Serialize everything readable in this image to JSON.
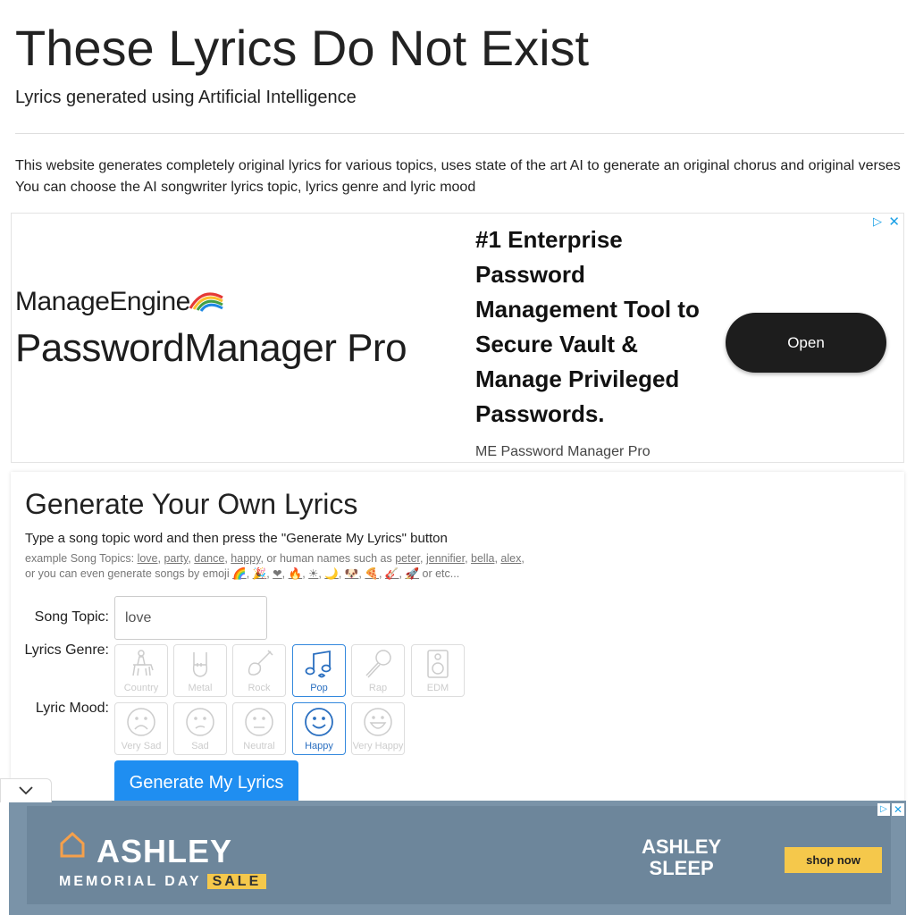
{
  "header": {
    "title": "These Lyrics Do Not Exist",
    "subtitle": "Lyrics generated using Artificial Intelligence"
  },
  "intro": {
    "line1": "This website generates completely original lyrics for various topics, uses state of the art AI to generate an original chorus and original verses",
    "line2": "You can choose the AI songwriter lyrics topic, lyrics genre and lyric mood"
  },
  "ad_top": {
    "brand_top": "ManageEngine",
    "brand_main": "PasswordManager Pro",
    "headline": "#1 Enterprise Password Management Tool to Secure Vault & Manage Privileged Passwords.",
    "advertiser": "ME Password Manager Pro",
    "open_label": "Open",
    "adchoices_icon": "adchoices-icon",
    "close_icon": "close-icon"
  },
  "generator": {
    "heading": "Generate Your Own Lyrics",
    "instruction": "Type a song topic word and then press the \"Generate My Lyrics\" button",
    "examples_prefix": "example Song Topics:",
    "topic_examples": [
      "love",
      "party",
      "dance",
      "happy"
    ],
    "names_prefix": ", or human names such as",
    "name_examples": [
      "peter",
      "jennifier",
      "bella",
      "alex"
    ],
    "emoji_prefix": "or you can even generate songs by emoji",
    "emoji_examples": [
      "🌈",
      "🎉",
      "❤",
      "🔥",
      "☀",
      "🌙",
      "🐶",
      "🍕",
      "🎸",
      "🚀"
    ],
    "emoji_suffix": "or etc...",
    "topic_label": "Song Topic:",
    "topic_value": "love",
    "genre_label": "Lyrics Genre:",
    "genres": [
      {
        "label": "Country",
        "icon": "horse-rider-icon",
        "selected": false
      },
      {
        "label": "Metal",
        "icon": "rock-hand-icon",
        "selected": false
      },
      {
        "label": "Rock",
        "icon": "electric-guitar-icon",
        "selected": false
      },
      {
        "label": "Pop",
        "icon": "music-note-icon",
        "selected": true
      },
      {
        "label": "Rap",
        "icon": "microphone-icon",
        "selected": false
      },
      {
        "label": "EDM",
        "icon": "speaker-icon",
        "selected": false
      }
    ],
    "mood_label": "Lyric Mood:",
    "moods": [
      {
        "label": "Very Sad",
        "icon": "very-sad-face-icon",
        "selected": false
      },
      {
        "label": "Sad",
        "icon": "sad-face-icon",
        "selected": false
      },
      {
        "label": "Neutral",
        "icon": "neutral-face-icon",
        "selected": false
      },
      {
        "label": "Happy",
        "icon": "happy-face-icon",
        "selected": true
      },
      {
        "label": "Very Happy",
        "icon": "very-happy-face-icon",
        "selected": false
      }
    ],
    "generate_label": "Generate My Lyrics"
  },
  "ad_bottom": {
    "brand": "ASHLEY",
    "sale_text": "MEMORIAL DAY",
    "sale_tag": "SALE",
    "sleep_line1": "ASHLEY",
    "sleep_line2": "SLEEP",
    "shop_label": "shop now"
  },
  "colors": {
    "accent": "#1f8ef1",
    "selected_border": "#3388dd",
    "ad_button": "#1d1d1d",
    "ashley_yellow": "#f5c84b"
  }
}
